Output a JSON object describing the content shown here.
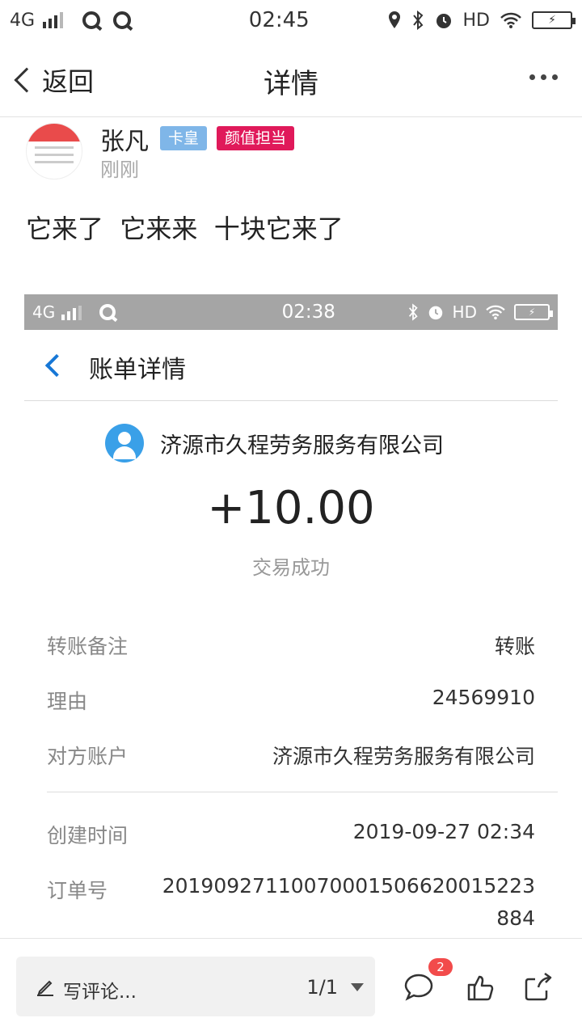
{
  "status_bar": {
    "network": "4G",
    "time": "02:45",
    "hd": "HD"
  },
  "nav": {
    "back_label": "返回",
    "title": "详情"
  },
  "post": {
    "author": "张凡",
    "badges": [
      "卡皇",
      "颜值担当"
    ],
    "time": "刚刚",
    "text": "它来了  它来来  十块它来了"
  },
  "screenshot": {
    "status_bar": {
      "network": "4G",
      "time": "02:38",
      "hd": "HD"
    },
    "title": "账单详情",
    "payee": "济源市久程劳务服务有限公司",
    "amount": "+10.00",
    "status": "交易成功",
    "details": [
      {
        "key": "转账备注",
        "value": "转账"
      },
      {
        "key": "理由",
        "value": "24569910"
      },
      {
        "key": "对方账户",
        "value": "济源市久程劳务服务有限公司"
      }
    ],
    "extra": [
      {
        "key": "创建时间",
        "value": "2019-09-27 02:34"
      },
      {
        "key": "订单号",
        "value": "20190927110070001506620015223884"
      }
    ]
  },
  "bottom_bar": {
    "comment_placeholder": "写评论...",
    "page_indicator": "1/1",
    "comment_count": "2"
  },
  "colors": {
    "accent_blue": "#1677d6",
    "badge_blue": "#7fb6e8",
    "badge_red": "#e0195a",
    "count_red": "#f24b4b"
  }
}
